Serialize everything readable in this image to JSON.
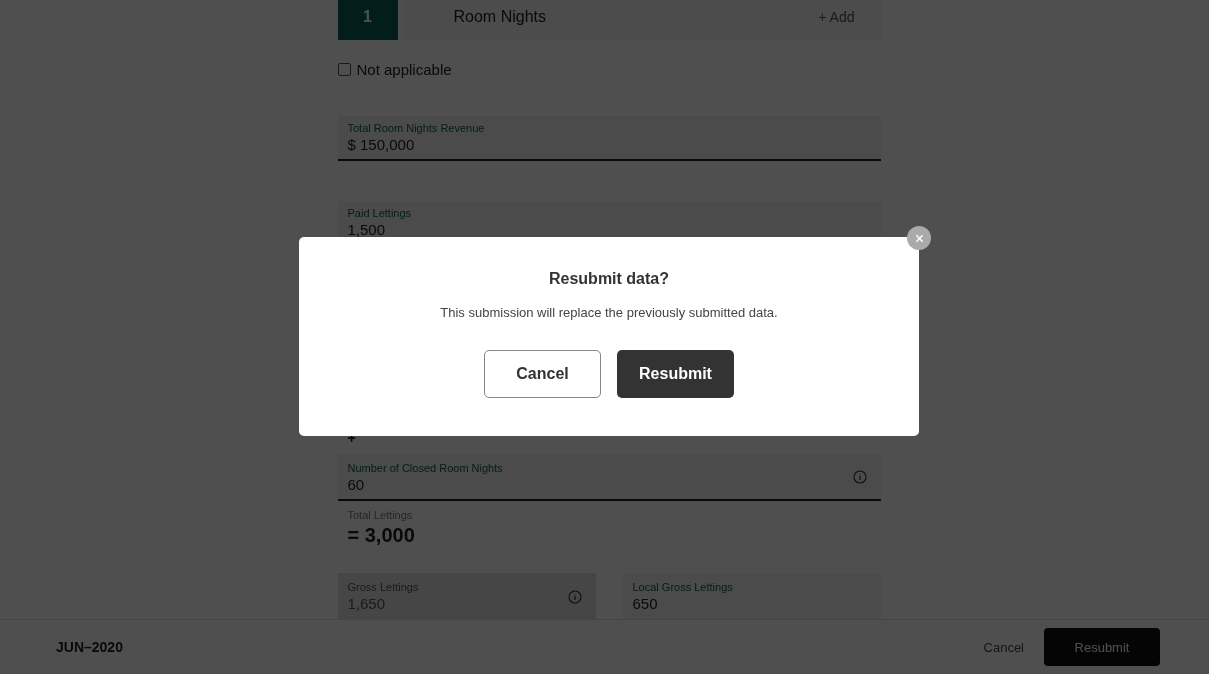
{
  "step": {
    "number": "1",
    "title": "Room Nights",
    "add_label": "+ Add"
  },
  "not_applicable": {
    "label": "Not applicable",
    "checked": false
  },
  "revenue_field": {
    "label": "Total Room Nights Revenue",
    "value": "$ 150,000"
  },
  "paid_field": {
    "label": "Paid Lettings",
    "value": "1,500"
  },
  "operator": "+",
  "closed_field": {
    "label": "Number of Closed Room Nights",
    "value": "60",
    "info": true
  },
  "total": {
    "label": "Total Lettings",
    "value": "= 3,000"
  },
  "split_fields": [
    {
      "label": "Gross Lettings",
      "value": "1,650",
      "disabled": true,
      "info": true
    },
    {
      "label": "Local Gross Lettings",
      "value": "650",
      "disabled": false,
      "info": false
    }
  ],
  "footer": {
    "period": "JUN–2020",
    "cancel": "Cancel",
    "submit": "Resubmit"
  },
  "dialog": {
    "title": "Resubmit data?",
    "message": "This submission will replace the previously submitted data.",
    "cancel": "Cancel",
    "confirm": "Resubmit"
  }
}
